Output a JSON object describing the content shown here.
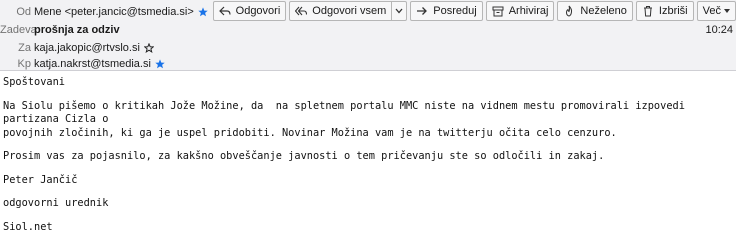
{
  "header": {
    "from_label": "Od",
    "from_value": "Mene <peter.jancic@tsmedia.si>",
    "subject_label": "Zadeva",
    "subject_value": "prošnja za odziv",
    "to_label": "Za",
    "to_value": "kaja.jakopic@rtvslo.si",
    "cc_label": "Kp",
    "cc_value": "katja.nakrst@tsmedia.si",
    "time": "10:24"
  },
  "toolbar": {
    "reply": "Odgovori",
    "reply_all": "Odgovori vsem",
    "forward": "Posreduj",
    "archive": "Arhiviraj",
    "junk": "Neželeno",
    "delete": "Izbriši",
    "more": "Več"
  },
  "body": {
    "greeting": "Spoštovani",
    "p1_line1": "Na Siolu pišemo o kritikah Jože Možine, da  na spletnem portalu MMC niste na vidnem mestu promovirali izpovedi partizana Cizla o",
    "p1_line2": "povojnih zločinih, ki ga je uspel pridobiti. Novinar Možina vam je na twitterju očita celo cenzuro.",
    "request": "Prosim vas za pojasnilo, za kakšno obveščanje javnosti o tem pričevanju ste so odločili in zakaj.",
    "signature_name": "Peter Jančič",
    "signature_role": "odgovorni urednik",
    "signature_site": "Siol.net"
  },
  "colors": {
    "header_bg": "#f2f2f4",
    "star_blue": "#1a73e8",
    "label_gray": "#737373"
  }
}
